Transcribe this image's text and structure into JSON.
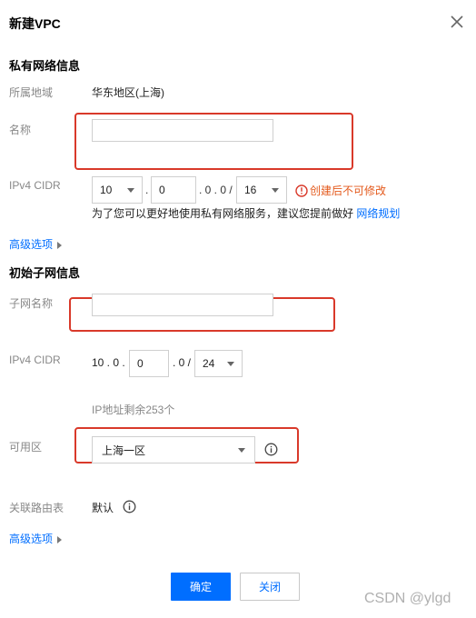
{
  "dialog": {
    "title": "新建VPC"
  },
  "vpc_section": {
    "heading": "私有网络信息",
    "region_label": "所属地域",
    "region_value": "华东地区(上海)",
    "name_label": "名称",
    "name_value": "",
    "cidr_label": "IPv4 CIDR",
    "cidr_first_octet": "10",
    "cidr_second_octet": "0",
    "cidr_fixed_suffix": ". 0 . 0 /",
    "cidr_mask": "16",
    "cidr_dot": ".",
    "warning_text": "创建后不可修改",
    "help_text": "为了您可以更好地使用私有网络服务，建议您提前做好",
    "help_link": "网络规划",
    "advanced_label": "高级选项"
  },
  "subnet_section": {
    "heading": "初始子网信息",
    "name_label": "子网名称",
    "name_value": "",
    "cidr_label": "IPv4 CIDR",
    "cidr_prefix": "10 . 0 .",
    "cidr_third_octet": "0",
    "cidr_suffix": ". 0 /",
    "cidr_mask": "24",
    "ip_remaining": "IP地址剩余253个",
    "zone_label": "可用区",
    "zone_value": "上海一区",
    "route_table_label": "关联路由表",
    "route_table_value": "默认",
    "advanced_label": "高级选项"
  },
  "footer": {
    "confirm_label": "确定",
    "close_label": "关闭"
  },
  "watermark": "CSDN @ylgd",
  "colors": {
    "primary": "#006eff",
    "warning": "#e45a1d",
    "highlight_box": "#d9392a"
  }
}
